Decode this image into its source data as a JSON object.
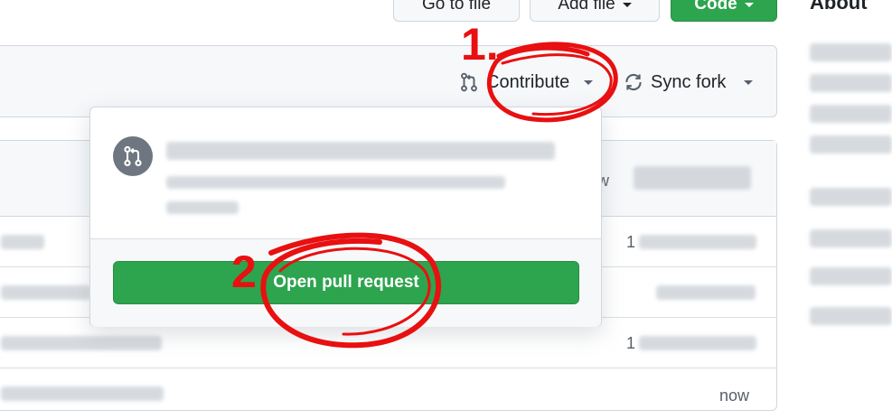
{
  "toolbar": {
    "go_to_file": "Go to file",
    "add_file": "Add file",
    "code": "Code"
  },
  "sidebar": {
    "about_heading": "About"
  },
  "banner": {
    "contribute_label": "Contribute",
    "sync_fork_label": "Sync fork"
  },
  "popup": {
    "open_pull_request_label": "Open pull request"
  },
  "table": {
    "header_time": "now",
    "rows": [
      {
        "time": "1"
      },
      {
        "time": ""
      },
      {
        "time": "1"
      },
      {
        "time": "now"
      }
    ]
  },
  "annotations": {
    "step1": "1.",
    "step2": "2"
  },
  "colors": {
    "accent_green": "#2da44e",
    "annotation_red": "#e81010",
    "border": "#d0d7de",
    "subtle_bg": "#f6f8fa"
  },
  "icons": {
    "contribute": "git-pull-request-icon",
    "sync": "sync-icon",
    "popup_avatar": "git-pull-request-icon"
  }
}
